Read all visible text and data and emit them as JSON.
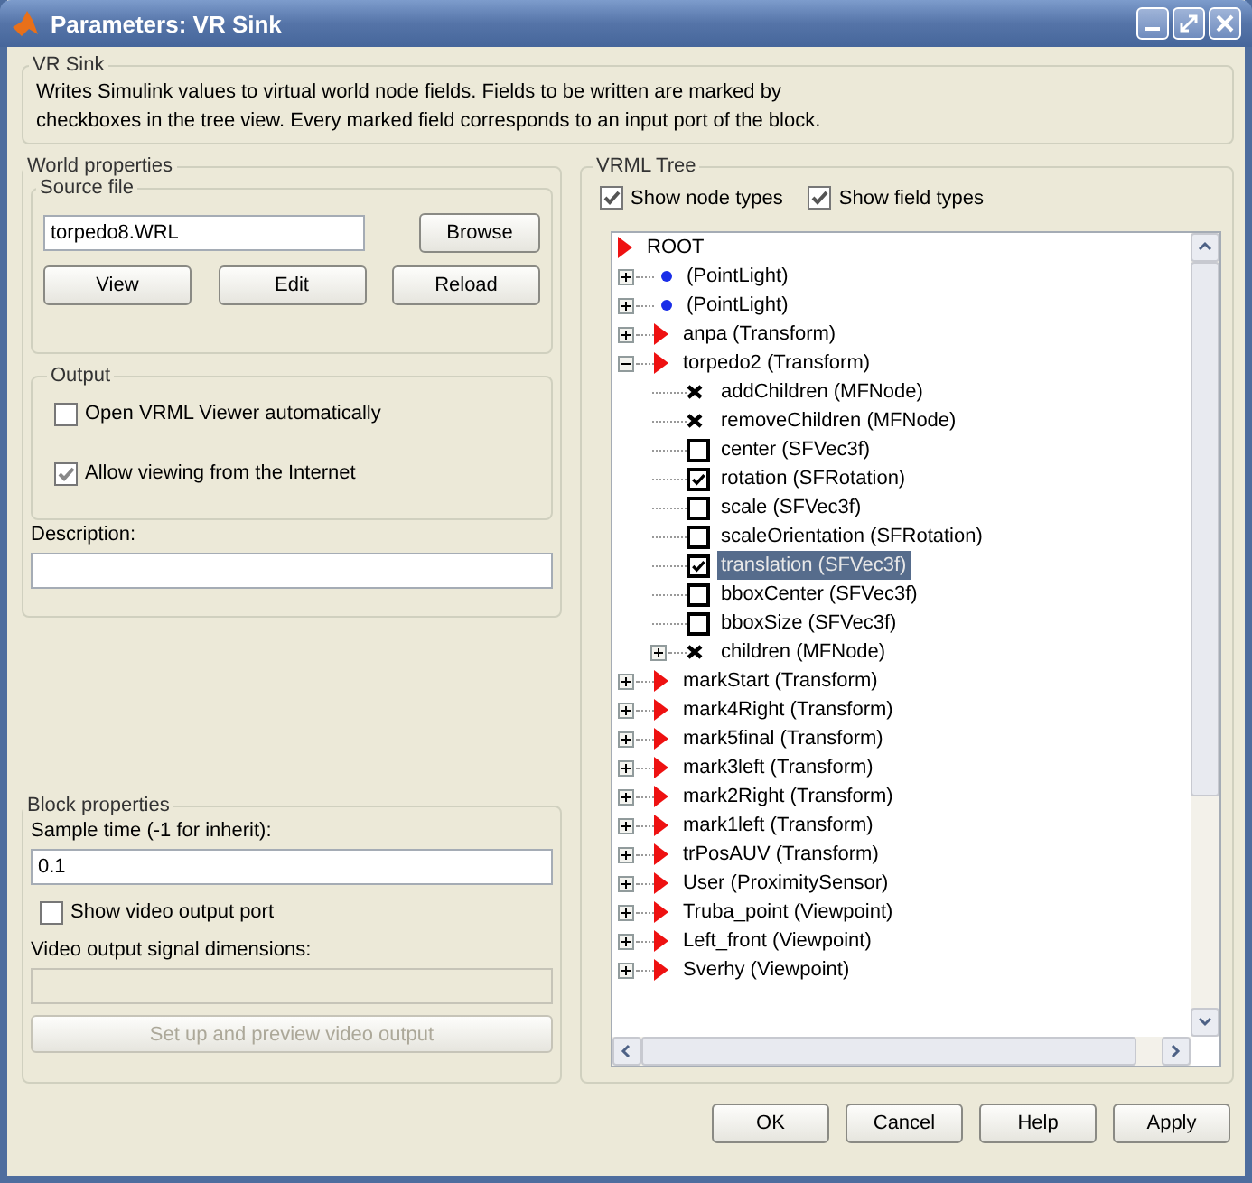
{
  "window": {
    "title": "Parameters: VR Sink"
  },
  "intro": {
    "title": "VR Sink",
    "text": "Writes Simulink values to virtual world node fields. Fields to be written are marked by checkboxes in the tree view. Every marked field corresponds to an input port of the block."
  },
  "world_properties": {
    "title": "World properties",
    "source_file": {
      "title": "Source file",
      "value": "torpedo8.WRL",
      "browse": "Browse",
      "buttons": [
        "View",
        "Edit",
        "Reload"
      ]
    },
    "output": {
      "title": "Output",
      "options": [
        {
          "label": "Open VRML Viewer automatically",
          "checked": false
        },
        {
          "label": "Allow viewing from the Internet",
          "checked": true
        }
      ]
    },
    "description": {
      "label": "Description:"
    }
  },
  "block_properties": {
    "title": "Block properties",
    "sample_time": {
      "label": "Sample time (-1 for inherit):",
      "value": "0.1"
    },
    "video_port": {
      "label": "Show video output port",
      "checked": false
    },
    "video_dims": {
      "label": "Video output signal dimensions:",
      "disabled": true
    },
    "preview": {
      "label": "Set up and preview video output",
      "disabled": true
    }
  },
  "vrml_tree": {
    "title": "VRML Tree",
    "options": [
      {
        "label": "Show node types",
        "checked": true
      },
      {
        "label": "Show field types",
        "checked": true
      }
    ],
    "nodes": [
      {
        "label": "ROOT",
        "kind": "node",
        "selected": false,
        "children": [
          {
            "label": "(PointLight)",
            "kind": "light",
            "expanded": false,
            "selected": false
          },
          {
            "label": "(PointLight)",
            "kind": "light",
            "expanded": false,
            "selected": false
          },
          {
            "label": "anpa (Transform)",
            "kind": "node",
            "expanded": false,
            "selected": false
          },
          {
            "label": "torpedo2 (Transform)",
            "kind": "node",
            "expanded": true,
            "selected": false,
            "children": [
              {
                "label": "addChildren (MFNode)",
                "kind": "fixed_field",
                "selected": false
              },
              {
                "label": "removeChildren (MFNode)",
                "kind": "fixed_field",
                "selected": false
              },
              {
                "label": "center (SFVec3f)",
                "kind": "field",
                "checked": false,
                "selected": false
              },
              {
                "label": "rotation (SFRotation)",
                "kind": "field",
                "checked": true,
                "selected": false
              },
              {
                "label": "scale (SFVec3f)",
                "kind": "field",
                "checked": false,
                "selected": false
              },
              {
                "label": "scaleOrientation (SFRotation)",
                "kind": "field",
                "checked": false,
                "selected": false
              },
              {
                "label": "translation (SFVec3f)",
                "kind": "field",
                "checked": true,
                "selected": true
              },
              {
                "label": "bboxCenter (SFVec3f)",
                "kind": "field",
                "checked": false,
                "selected": false
              },
              {
                "label": "bboxSize (SFVec3f)",
                "kind": "field",
                "checked": false,
                "selected": false
              },
              {
                "label": "children (MFNode)",
                "kind": "fixed_field",
                "expanded": false,
                "selected": false
              }
            ]
          },
          {
            "label": "markStart (Transform)",
            "kind": "node",
            "expanded": false,
            "selected": false
          },
          {
            "label": "mark4Right (Transform)",
            "kind": "node",
            "expanded": false,
            "selected": false
          },
          {
            "label": "mark5final (Transform)",
            "kind": "node",
            "expanded": false,
            "selected": false
          },
          {
            "label": "mark3left (Transform)",
            "kind": "node",
            "expanded": false,
            "selected": false
          },
          {
            "label": "mark2Right (Transform)",
            "kind": "node",
            "expanded": false,
            "selected": false
          },
          {
            "label": "mark1left (Transform)",
            "kind": "node",
            "expanded": false,
            "selected": false
          },
          {
            "label": "trPosAUV (Transform)",
            "kind": "node",
            "expanded": false,
            "selected": false
          },
          {
            "label": "User (ProximitySensor)",
            "kind": "node",
            "expanded": false,
            "selected": false
          },
          {
            "label": "Truba_point (Viewpoint)",
            "kind": "node",
            "expanded": false,
            "selected": false
          },
          {
            "label": "Left_front (Viewpoint)",
            "kind": "node",
            "expanded": false,
            "selected": false
          },
          {
            "label": "Sverhy (Viewpoint)",
            "kind": "node",
            "expanded": false,
            "selected": false
          }
        ]
      }
    ]
  },
  "buttons": [
    {
      "label": "OK"
    },
    {
      "label": "Cancel"
    },
    {
      "label": "Help"
    },
    {
      "label": "Apply"
    }
  ]
}
